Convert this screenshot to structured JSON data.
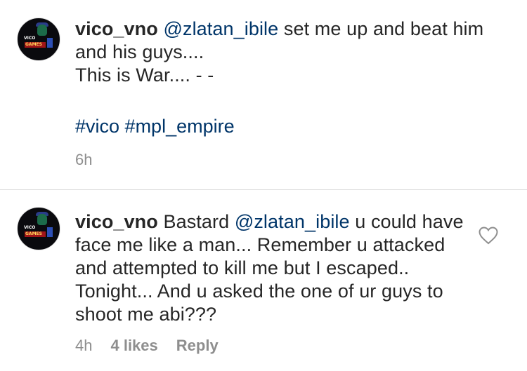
{
  "comments": [
    {
      "username": "vico_vno",
      "mention": "@zlatan_ibile",
      "text_after_mention": " set me up and beat him and his guys....",
      "line2": "This is War.... - -",
      "hashtag1": "#vico",
      "hashtag2": "#mpl_empire",
      "time": "6h",
      "avatar": {
        "label1": "VICO",
        "label2": "GAMES"
      }
    },
    {
      "username": "vico_vno",
      "text_before_mention": "Bastard ",
      "mention": "@zlatan_ibile",
      "text_after_mention": " u could have face me like a man... Remember u attacked and attempted to kill me but I escaped.. Tonight... And u asked the one of ur guys to shoot me abi???",
      "time": "4h",
      "likes": "4 likes",
      "reply_label": "Reply",
      "avatar": {
        "label1": "VICO",
        "label2": "GAMES"
      },
      "like_icon": "heart-outline-icon"
    }
  ],
  "colors": {
    "link": "#003569",
    "muted": "#8e8e8e",
    "text": "#262626",
    "divider": "#dbdbdb"
  }
}
